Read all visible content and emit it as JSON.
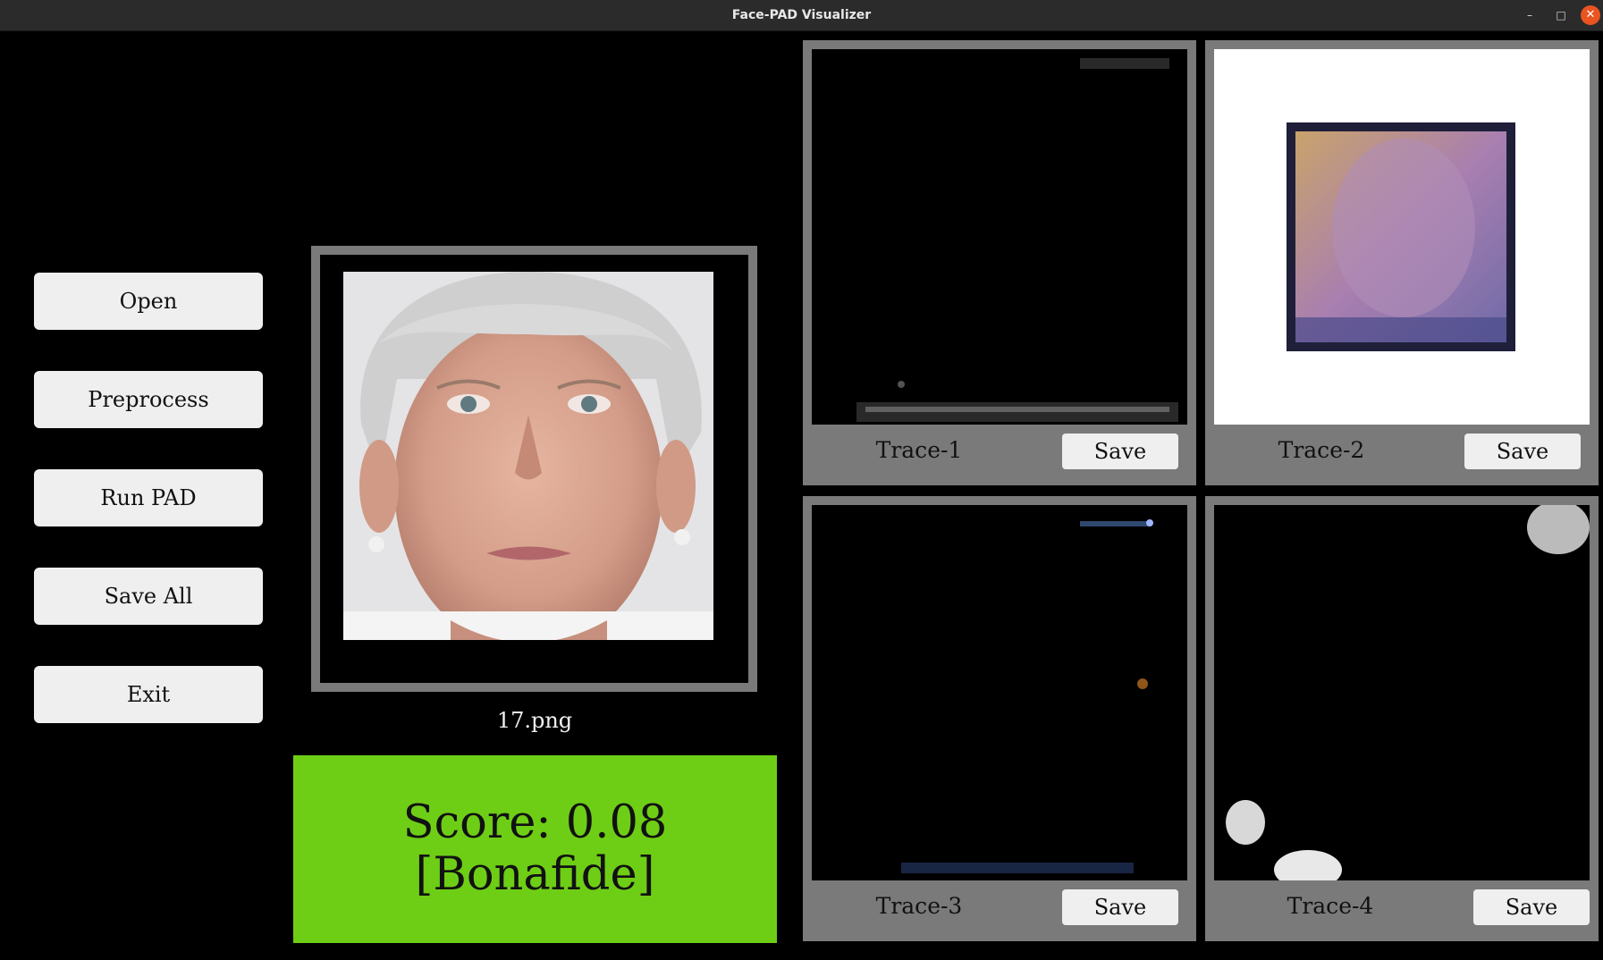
{
  "window": {
    "title": "Face-PAD Visualizer"
  },
  "controls": {
    "minimize_icon": "–",
    "maximize_icon": "□",
    "close_icon": "✕"
  },
  "sidebar": {
    "buttons": [
      {
        "label": "Open"
      },
      {
        "label": "Preprocess"
      },
      {
        "label": "Run PAD"
      },
      {
        "label": "Save All"
      },
      {
        "label": "Exit"
      }
    ]
  },
  "main": {
    "filename": "17.png",
    "score_line1": "Score: 0.08",
    "score_line2": "[Bonafide]",
    "score_color": "#6ece16"
  },
  "traces": [
    {
      "label": "Trace-1",
      "save_label": "Save"
    },
    {
      "label": "Trace-2",
      "save_label": "Save"
    },
    {
      "label": "Trace-3",
      "save_label": "Save"
    },
    {
      "label": "Trace-4",
      "save_label": "Save"
    }
  ]
}
